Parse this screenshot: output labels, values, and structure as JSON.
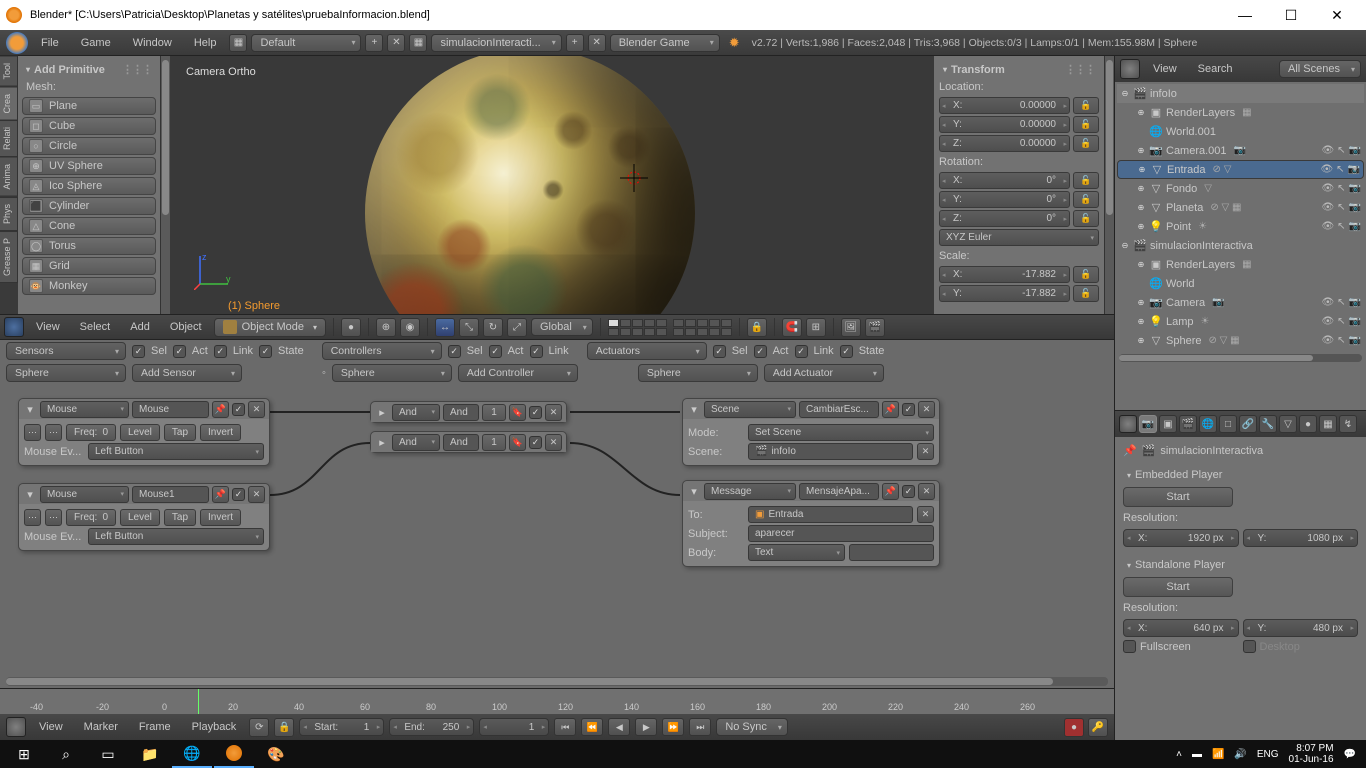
{
  "titlebar": {
    "title": "Blender* [C:\\Users\\Patricia\\Desktop\\Planetas y satélites\\pruebaInformacion.blend]"
  },
  "window_controls": {
    "min": "—",
    "max": "☐",
    "close": "✕"
  },
  "infobar": {
    "menus": [
      "File",
      "Game",
      "Window",
      "Help"
    ],
    "layout": "Default",
    "scene": "simulacionInteracti...",
    "engine": "Blender Game",
    "stats": "v2.72 | Verts:1,986 | Faces:2,048 | Tris:3,968 | Objects:0/3 | Lamps:0/1 | Mem:155.98M | Sphere"
  },
  "toolshelf": {
    "tabs": [
      "Tool",
      "Crea",
      "Relati",
      "Anima",
      "Phys",
      "Grease P"
    ],
    "panel_title": "Add Primitive",
    "mesh_label": "Mesh:",
    "primitives": [
      "Plane",
      "Cube",
      "Circle",
      "UV Sphere",
      "Ico Sphere",
      "Cylinder",
      "Cone",
      "Torus",
      "Grid",
      "Monkey"
    ]
  },
  "viewport": {
    "camera_label": "Camera Ortho",
    "object_label": "(1) Sphere"
  },
  "npanel": {
    "title": "Transform",
    "location_label": "Location:",
    "loc": [
      [
        "X:",
        "0.00000"
      ],
      [
        "Y:",
        "0.00000"
      ],
      [
        "Z:",
        "0.00000"
      ]
    ],
    "rotation_label": "Rotation:",
    "rot": [
      [
        "X:",
        "0°"
      ],
      [
        "Y:",
        "0°"
      ],
      [
        "Z:",
        "0°"
      ]
    ],
    "rot_mode": "XYZ Euler",
    "scale_label": "Scale:",
    "scale": [
      [
        "X:",
        "-17.882"
      ],
      [
        "Y:",
        "-17.882"
      ]
    ]
  },
  "vp_header": {
    "menus": [
      "View",
      "Select",
      "Add",
      "Object"
    ],
    "mode": "Object Mode",
    "orientation": "Global"
  },
  "logic": {
    "columns": {
      "sensors": {
        "label": "Sensors",
        "checks": [
          "Sel",
          "Act",
          "Link",
          "State"
        ]
      },
      "controllers": {
        "label": "Controllers",
        "checks": [
          "Sel",
          "Act",
          "Link"
        ]
      },
      "actuators": {
        "label": "Actuators",
        "checks": [
          "Sel",
          "Act",
          "Link",
          "State"
        ]
      }
    },
    "target": "Sphere",
    "add_sensor": "Add Sensor",
    "add_controller": "Add Controller",
    "add_actuator": "Add Actuator",
    "sensor1": {
      "type": "Mouse",
      "name": "Mouse",
      "freq_label": "Freq:",
      "freq": "0",
      "level": "Level",
      "tap": "Tap",
      "invert": "Invert",
      "event_label": "Mouse Ev...",
      "event": "Left Button"
    },
    "sensor2": {
      "type": "Mouse",
      "name": "Mouse1",
      "freq_label": "Freq:",
      "freq": "0",
      "level": "Level",
      "tap": "Tap",
      "invert": "Invert",
      "event_label": "Mouse Ev...",
      "event": "Left Button"
    },
    "ctrl1": {
      "type": "And",
      "name": "And",
      "val": "1"
    },
    "ctrl2": {
      "type": "And",
      "name": "And",
      "val": "1"
    },
    "act1": {
      "type": "Scene",
      "name": "CambiarEsc...",
      "mode_label": "Mode:",
      "mode": "Set Scene",
      "scene_label": "Scene:",
      "scene": "infoIo"
    },
    "act2": {
      "type": "Message",
      "name": "MensajeApa...",
      "to_label": "To:",
      "to": "Entrada",
      "subject_label": "Subject:",
      "subject": "aparecer",
      "body_label": "Body:",
      "body": "Text"
    }
  },
  "timeline": {
    "ticks": [
      "-40",
      "-20",
      "0",
      "20",
      "40",
      "60",
      "80",
      "100",
      "120",
      "140",
      "160",
      "180",
      "200",
      "220",
      "240",
      "260"
    ],
    "menus": [
      "View",
      "Marker",
      "Frame",
      "Playback"
    ],
    "start_label": "Start:",
    "start": "1",
    "end_label": "End:",
    "end": "250",
    "current": "1",
    "sync": "No Sync"
  },
  "outliner": {
    "menus": [
      "View",
      "Search"
    ],
    "filter": "All Scenes",
    "items": [
      {
        "indent": 0,
        "exp": "⊖",
        "icon": "🎬",
        "name": "infoIo",
        "hilite": true
      },
      {
        "indent": 1,
        "exp": "⊕",
        "icon": "▣",
        "name": "RenderLayers",
        "extra": "▦"
      },
      {
        "indent": 1,
        "exp": "",
        "icon": "🌐",
        "name": "World.001"
      },
      {
        "indent": 1,
        "exp": "⊕",
        "icon": "📷",
        "name": "Camera.001",
        "extra": "📷",
        "restrict": true
      },
      {
        "indent": 1,
        "exp": "⊕",
        "icon": "▽",
        "name": "Entrada",
        "extra": "⊘ ▽",
        "restrict": true,
        "sel": true
      },
      {
        "indent": 1,
        "exp": "⊕",
        "icon": "▽",
        "name": "Fondo",
        "extra": "▽",
        "restrict": true
      },
      {
        "indent": 1,
        "exp": "⊕",
        "icon": "▽",
        "name": "Planeta",
        "extra": "⊘ ▽ ▦",
        "restrict": true
      },
      {
        "indent": 1,
        "exp": "⊕",
        "icon": "💡",
        "name": "Point",
        "extra": "☀",
        "restrict": true
      },
      {
        "indent": 0,
        "exp": "⊖",
        "icon": "🎬",
        "name": "simulacionInteractiva"
      },
      {
        "indent": 1,
        "exp": "⊕",
        "icon": "▣",
        "name": "RenderLayers",
        "extra": "▦"
      },
      {
        "indent": 1,
        "exp": "",
        "icon": "🌐",
        "name": "World"
      },
      {
        "indent": 1,
        "exp": "⊕",
        "icon": "📷",
        "name": "Camera",
        "extra": "📷",
        "restrict": true
      },
      {
        "indent": 1,
        "exp": "⊕",
        "icon": "💡",
        "name": "Lamp",
        "extra": "☀",
        "restrict": true
      },
      {
        "indent": 1,
        "exp": "⊕",
        "icon": "▽",
        "name": "Sphere",
        "extra": "⊘ ▽ ▦",
        "restrict": true
      }
    ]
  },
  "properties": {
    "breadcrumb": "simulacionInteractiva",
    "embedded": {
      "title": "Embedded Player",
      "start": "Start",
      "res_label": "Resolution:",
      "x_label": "X:",
      "x": "1920 px",
      "y_label": "Y:",
      "y": "1080 px"
    },
    "standalone": {
      "title": "Standalone Player",
      "start": "Start",
      "res_label": "Resolution:",
      "x_label": "X:",
      "x": "640 px",
      "y_label": "Y:",
      "y": "480 px",
      "fullscreen": "Fullscreen",
      "desktop": "Desktop"
    }
  },
  "taskbar": {
    "lang": "ENG",
    "time": "8:07 PM",
    "date": "01-Jun-16"
  }
}
